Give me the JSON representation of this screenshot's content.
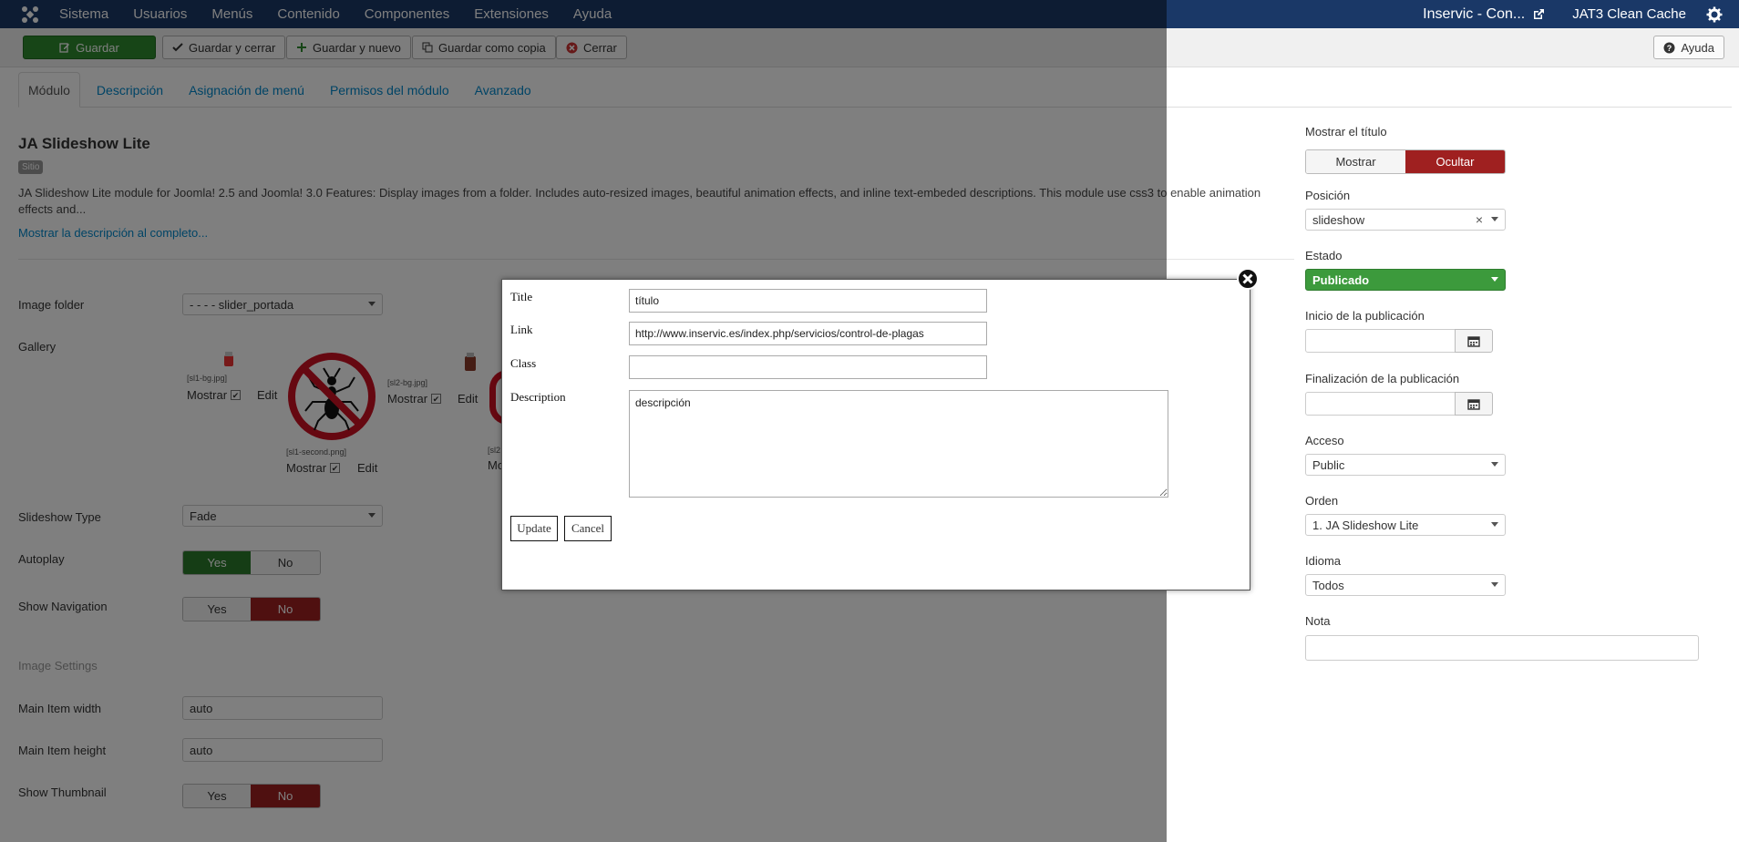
{
  "topbar": {
    "menu": [
      "Sistema",
      "Usuarios",
      "Menús",
      "Contenido",
      "Componentes",
      "Extensiones",
      "Ayuda"
    ],
    "site_name": "Inservic - Con...",
    "cache": "JAT3 Clean Cache"
  },
  "toolbar": {
    "save": "Guardar",
    "save_close": "Guardar y cerrar",
    "save_new": "Guardar y nuevo",
    "save_copy": "Guardar como copia",
    "close": "Cerrar",
    "help": "Ayuda"
  },
  "tabs": [
    "Módulo",
    "Descripción",
    "Asignación de menú",
    "Permisos del módulo",
    "Avanzado"
  ],
  "module": {
    "title": "JA Slideshow Lite",
    "badge": "Sitio",
    "description": "JA Slideshow Lite module for Joomla! 2.5 and Joomla! 3.0 Features: Display images from a folder. Includes auto-resized images, beautiful animation effects, and inline text-embeded descriptions. This module use css3 to enable animation effects and...",
    "more_link": "Mostrar la descripción al completo..."
  },
  "form": {
    "image_folder_label": "Image folder",
    "image_folder_value": "- - - - slider_portada",
    "gallery_label": "Gallery",
    "gallery_items": [
      {
        "file": "[sl1-bg.jpg]",
        "show": "Mostrar",
        "edit": "Edit"
      },
      {
        "file": "[sl1-second.png]",
        "show": "Mostrar",
        "edit": "Edit"
      },
      {
        "file": "[sl2-bg.jpg]",
        "show": "Mostrar",
        "edit": "Edit"
      },
      {
        "file": "[sl2",
        "show": "Mo"
      }
    ],
    "slideshow_type_label": "Slideshow Type",
    "slideshow_type_value": "Fade",
    "autoplay_label": "Autoplay",
    "show_navigation_label": "Show Navigation",
    "yes": "Yes",
    "no": "No",
    "image_settings": "Image Settings",
    "main_width_label": "Main Item width",
    "main_width_value": "auto",
    "main_height_label": "Main Item height",
    "main_height_value": "auto",
    "show_thumbnail_label": "Show Thumbnail"
  },
  "sidebar": {
    "show_title_label": "Mostrar el título",
    "show": "Mostrar",
    "hide": "Ocultar",
    "position_label": "Posición",
    "position_value": "slideshow",
    "state_label": "Estado",
    "state_value": "Publicado",
    "publish_up_label": "Inicio de la publicación",
    "publish_down_label": "Finalización de la publicación",
    "access_label": "Acceso",
    "access_value": "Public",
    "order_label": "Orden",
    "order_value": "1. JA Slideshow Lite",
    "language_label": "Idioma",
    "language_value": "Todos",
    "note_label": "Nota"
  },
  "modal": {
    "title_label": "Title",
    "title_value": "título",
    "link_label": "Link",
    "link_value": "http://www.inservic.es/index.php/servicios/control-de-plagas",
    "class_label": "Class",
    "class_value": "",
    "description_label": "Description",
    "description_value": "descripción",
    "update": "Update",
    "cancel": "Cancel"
  },
  "colors": {
    "topbar": "#1a3867",
    "green": "#2f8a2f",
    "red": "#9f2020"
  }
}
